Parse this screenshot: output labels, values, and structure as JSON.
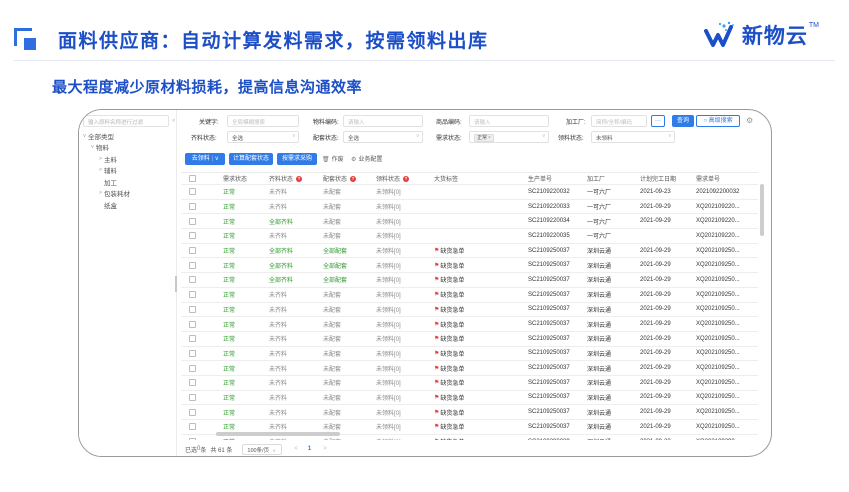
{
  "slide": {
    "title": "面料供应商：自动计算发料需求，按需领料出库",
    "subtitle": "最大程度减少原材料损耗，提高信息沟通效率",
    "brand_name": "新物云",
    "brand_tm": "TM",
    "brand_color": "#1c4fc7"
  },
  "tree": {
    "search_placeholder": "输入原料名称进行过滤",
    "items": [
      {
        "label": "全部类型",
        "level": 0,
        "arrow": "v"
      },
      {
        "label": "物料",
        "level": 1,
        "arrow": "v"
      },
      {
        "label": "主料",
        "level": 2,
        "arrow": ">"
      },
      {
        "label": "辅料",
        "level": 2,
        "arrow": ">"
      },
      {
        "label": "加工",
        "level": 2,
        "arrow": ""
      },
      {
        "label": "包装耗材",
        "level": 2,
        "arrow": ">"
      },
      {
        "label": "纸盒",
        "level": 2,
        "arrow": ""
      }
    ]
  },
  "filters": {
    "keyword_label": "关键字:",
    "keyword_placeholder": "全局模糊搜索",
    "material_code_label": "物料编码:",
    "material_code_placeholder": "请输入",
    "product_code_label": "商品编码:",
    "product_code_placeholder": "请输入",
    "factory_label": "加工厂:",
    "factory_placeholder": "简称/全称/编码",
    "more_label": "···",
    "query_label": "查询",
    "advanced_label": "高级搜索",
    "prep_status_label": "齐料状态:",
    "prep_status_value": "全选",
    "dist_status_label": "配套状态:",
    "dist_status_value": "全选",
    "demand_status_label": "需求状态:",
    "demand_status_chip": "正常",
    "pick_status_label": "领料状态:",
    "pick_status_value": "未领料"
  },
  "toolbar": {
    "pick_label": "去领料",
    "pick_dropdown": "v",
    "calc_label": "计算配套状态",
    "purchase_label": "按需求采购",
    "void_label": "作废",
    "business_label": "业务配置"
  },
  "table": {
    "headers": [
      "需求状态",
      "齐料状态",
      "配套状态",
      "领料状态",
      "大货标签",
      "生产单号",
      "加工厂",
      "计划完工日期",
      "需求单号"
    ],
    "rows": [
      {
        "status": "正常",
        "prep": "未齐料",
        "dist": "未配套",
        "pick": "未领料[0]",
        "bulk": "",
        "order": "SC2109220032",
        "factory": "一可六厂",
        "date": "2021-09-23",
        "demand": "2021092200032"
      },
      {
        "status": "正常",
        "prep": "未齐料",
        "dist": "未配套",
        "pick": "未领料[0]",
        "bulk": "",
        "order": "SC2109220033",
        "factory": "一可六厂",
        "date": "2021-09-29",
        "demand": "XQ202109220..."
      },
      {
        "status": "正常",
        "prep": "全部齐料",
        "dist": "未配套",
        "pick": "未领料[0]",
        "bulk": "",
        "order": "SC2109220034",
        "factory": "一可六厂",
        "date": "2021-09-29",
        "demand": "XQ202109220..."
      },
      {
        "status": "正常",
        "prep": "未齐料",
        "dist": "未配套",
        "pick": "未领料[0]",
        "bulk": "",
        "order": "SC2109220035",
        "factory": "一可六厂",
        "date": "",
        "demand": "XQ202109220..."
      },
      {
        "status": "正常",
        "prep": "全部齐料",
        "dist": "全部配套",
        "pick": "未领料[0]",
        "bulk": "缺货急单",
        "order": "SC2109250037",
        "factory": "深圳云通",
        "date": "2021-09-29",
        "demand": "XQ202109250..."
      },
      {
        "status": "正常",
        "prep": "全部齐料",
        "dist": "全部配套",
        "pick": "未领料[0]",
        "bulk": "缺货急单",
        "order": "SC2109250037",
        "factory": "深圳云通",
        "date": "2021-09-29",
        "demand": "XQ202109250..."
      },
      {
        "status": "正常",
        "prep": "全部齐料",
        "dist": "全部配套",
        "pick": "未领料[0]",
        "bulk": "缺货急单",
        "order": "SC2109250037",
        "factory": "深圳云通",
        "date": "2021-09-29",
        "demand": "XQ202109250..."
      },
      {
        "status": "正常",
        "prep": "未齐料",
        "dist": "未配套",
        "pick": "未领料[0]",
        "bulk": "缺货急单",
        "order": "SC2109250037",
        "factory": "深圳云通",
        "date": "2021-09-29",
        "demand": "XQ202109250..."
      },
      {
        "status": "正常",
        "prep": "未齐料",
        "dist": "未配套",
        "pick": "未领料[0]",
        "bulk": "缺货急单",
        "order": "SC2109250037",
        "factory": "深圳云通",
        "date": "2021-09-29",
        "demand": "XQ202109250..."
      },
      {
        "status": "正常",
        "prep": "未齐料",
        "dist": "未配套",
        "pick": "未领料[0]",
        "bulk": "缺货急单",
        "order": "SC2109250037",
        "factory": "深圳云通",
        "date": "2021-09-29",
        "demand": "XQ202109250..."
      },
      {
        "status": "正常",
        "prep": "未齐料",
        "dist": "未配套",
        "pick": "未领料[0]",
        "bulk": "缺货急单",
        "order": "SC2109250037",
        "factory": "深圳云通",
        "date": "2021-09-29",
        "demand": "XQ202109250..."
      },
      {
        "status": "正常",
        "prep": "未齐料",
        "dist": "未配套",
        "pick": "未领料[0]",
        "bulk": "缺货急单",
        "order": "SC2109250037",
        "factory": "深圳云通",
        "date": "2021-09-29",
        "demand": "XQ202109250..."
      },
      {
        "status": "正常",
        "prep": "未齐料",
        "dist": "未配套",
        "pick": "未领料[0]",
        "bulk": "缺货急单",
        "order": "SC2109250037",
        "factory": "深圳云通",
        "date": "2021-09-29",
        "demand": "XQ202109250..."
      },
      {
        "status": "正常",
        "prep": "未齐料",
        "dist": "未配套",
        "pick": "未领料[0]",
        "bulk": "缺货急单",
        "order": "SC2109250037",
        "factory": "深圳云通",
        "date": "2021-09-29",
        "demand": "XQ202109250..."
      },
      {
        "status": "正常",
        "prep": "未齐料",
        "dist": "未配套",
        "pick": "未领料[0]",
        "bulk": "缺货急单",
        "order": "SC2109250037",
        "factory": "深圳云通",
        "date": "2021-09-29",
        "demand": "XQ202109250..."
      },
      {
        "status": "正常",
        "prep": "未齐料",
        "dist": "未配套",
        "pick": "未领料[0]",
        "bulk": "缺货急单",
        "order": "SC2109250037",
        "factory": "深圳云通",
        "date": "2021-09-29",
        "demand": "XQ202109250..."
      },
      {
        "status": "正常",
        "prep": "未齐料",
        "dist": "未配套",
        "pick": "未领料[0]",
        "bulk": "缺货急单",
        "order": "SC2109250037",
        "factory": "深圳云通",
        "date": "2021-09-29",
        "demand": "XQ202109250..."
      },
      {
        "status": "正常",
        "prep": "未齐料",
        "dist": "未配套",
        "pick": "未领料[0]",
        "bulk": "缺货急单",
        "order": "SC2109290039",
        "factory": "深圳云通",
        "date": "2021-09-23",
        "demand": "XQ202109290..."
      }
    ]
  },
  "pager": {
    "selected_prefix": "已选",
    "selected_count": "0",
    "selected_suffix": "条",
    "total": "共 61 条",
    "page_size": "100条/页",
    "prev": "<",
    "current": "1",
    "next": ">"
  },
  "colors": {
    "accent": "#2f7be8",
    "ok_green": "#2e9a2e",
    "flag_red": "#e63b3b"
  }
}
